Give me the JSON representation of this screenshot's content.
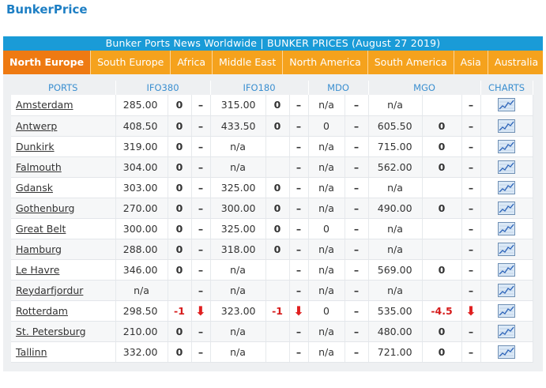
{
  "brand": "BunkerPrice",
  "banner": "Bunker Ports News Worldwide | BUNKER PRICES (August 27 2019)",
  "regions": [
    "North Europe",
    "South Europe",
    "Africa",
    "Middle East",
    "North America",
    "South America",
    "Asia",
    "Australia"
  ],
  "active_region": "North Europe",
  "columns": [
    "PORTS",
    "IFO380",
    "IFO180",
    "MDO",
    "MGO",
    "CHARTS"
  ],
  "colors": {
    "banner": "#1a9bd7",
    "tabs": "#f5a21d",
    "active_tab": "#ee7a12",
    "negative": "#d61c1c"
  },
  "chart_icon": "line-chart-icon",
  "rows": [
    {
      "port": "Amsterdam",
      "ifo380": [
        "285.00",
        "0",
        "–"
      ],
      "ifo180": [
        "315.00",
        "0",
        "–"
      ],
      "mdo": [
        "n/a",
        "",
        "–"
      ],
      "mgo": [
        "n/a",
        "",
        "–"
      ]
    },
    {
      "port": "Antwerp",
      "ifo380": [
        "408.50",
        "0",
        "–"
      ],
      "ifo180": [
        "433.50",
        "0",
        "–"
      ],
      "mdo": [
        "0",
        "",
        "–"
      ],
      "mgo": [
        "605.50",
        "0",
        "–"
      ]
    },
    {
      "port": "Dunkirk",
      "ifo380": [
        "319.00",
        "0",
        "–"
      ],
      "ifo180": [
        "n/a",
        "",
        "–"
      ],
      "mdo": [
        "n/a",
        "",
        "–"
      ],
      "mgo": [
        "715.00",
        "0",
        "–"
      ]
    },
    {
      "port": "Falmouth",
      "ifo380": [
        "304.00",
        "0",
        "–"
      ],
      "ifo180": [
        "n/a",
        "",
        "–"
      ],
      "mdo": [
        "n/a",
        "",
        "–"
      ],
      "mgo": [
        "562.00",
        "0",
        "–"
      ]
    },
    {
      "port": "Gdansk",
      "ifo380": [
        "303.00",
        "0",
        "–"
      ],
      "ifo180": [
        "325.00",
        "0",
        "–"
      ],
      "mdo": [
        "n/a",
        "",
        "–"
      ],
      "mgo": [
        "n/a",
        "",
        "–"
      ]
    },
    {
      "port": "Gothenburg",
      "ifo380": [
        "270.00",
        "0",
        "–"
      ],
      "ifo180": [
        "300.00",
        "0",
        "–"
      ],
      "mdo": [
        "n/a",
        "",
        "–"
      ],
      "mgo": [
        "490.00",
        "0",
        "–"
      ]
    },
    {
      "port": "Great Belt",
      "ifo380": [
        "300.00",
        "0",
        "–"
      ],
      "ifo180": [
        "325.00",
        "0",
        "–"
      ],
      "mdo": [
        "0",
        "",
        "–"
      ],
      "mgo": [
        "n/a",
        "",
        "–"
      ]
    },
    {
      "port": "Hamburg",
      "ifo380": [
        "288.00",
        "0",
        "–"
      ],
      "ifo180": [
        "318.00",
        "0",
        "–"
      ],
      "mdo": [
        "n/a",
        "",
        "–"
      ],
      "mgo": [
        "n/a",
        "",
        "–"
      ]
    },
    {
      "port": "Le Havre",
      "ifo380": [
        "346.00",
        "0",
        "–"
      ],
      "ifo180": [
        "n/a",
        "",
        "–"
      ],
      "mdo": [
        "n/a",
        "",
        "–"
      ],
      "mgo": [
        "569.00",
        "0",
        "–"
      ]
    },
    {
      "port": "Reydarfjordur",
      "ifo380": [
        "n/a",
        "",
        "–"
      ],
      "ifo180": [
        "n/a",
        "",
        "–"
      ],
      "mdo": [
        "n/a",
        "",
        "–"
      ],
      "mgo": [
        "n/a",
        "",
        "–"
      ]
    },
    {
      "port": "Rotterdam",
      "ifo380": [
        "298.50",
        "-1",
        "down"
      ],
      "ifo180": [
        "323.00",
        "-1",
        "down"
      ],
      "mdo": [
        "0",
        "",
        "–"
      ],
      "mgo": [
        "535.00",
        "-4.5",
        "down"
      ]
    },
    {
      "port": "St. Petersburg",
      "ifo380": [
        "210.00",
        "0",
        "–"
      ],
      "ifo180": [
        "n/a",
        "",
        "–"
      ],
      "mdo": [
        "n/a",
        "",
        "–"
      ],
      "mgo": [
        "480.00",
        "0",
        "–"
      ]
    },
    {
      "port": "Tallinn",
      "ifo380": [
        "332.00",
        "0",
        "–"
      ],
      "ifo180": [
        "n/a",
        "",
        "–"
      ],
      "mdo": [
        "n/a",
        "",
        "–"
      ],
      "mgo": [
        "721.00",
        "0",
        "–"
      ]
    }
  ]
}
